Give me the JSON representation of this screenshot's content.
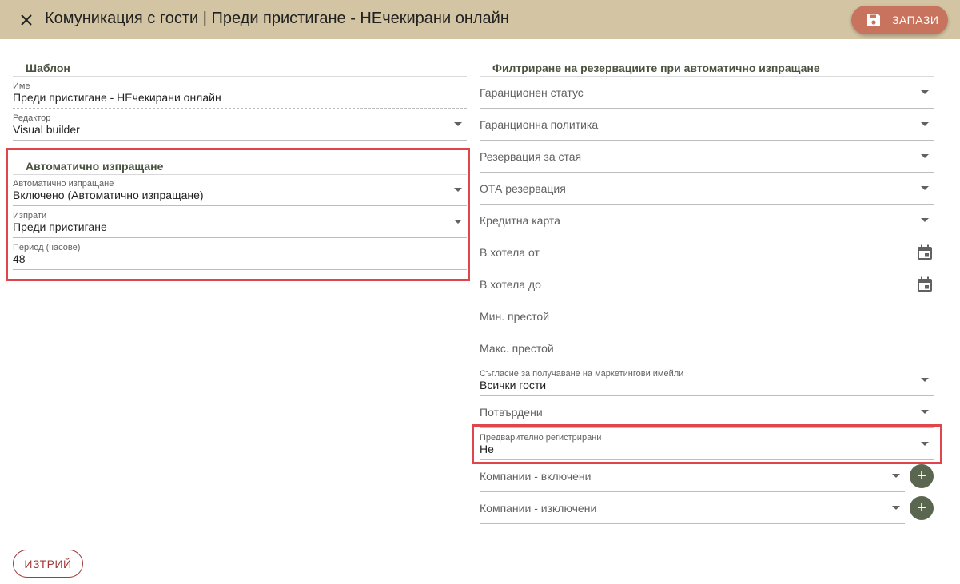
{
  "header": {
    "title": "Комуникация с гости | Преди пристигане - НЕчекирани онлайн",
    "save_label": "ЗАПАЗИ"
  },
  "template_section": {
    "title": "Шаблон",
    "name_label": "Име",
    "name_value": "Преди пристигане - НЕчекирани онлайн",
    "editor_label": "Редактор",
    "editor_value": "Visual builder"
  },
  "auto_send_section": {
    "title": "Автоматично изпращане",
    "auto_label": "Автоматично изпращане",
    "auto_value": "Включено (Автоматично изпращане)",
    "send_label": "Изпрати",
    "send_value": "Преди пристигане",
    "period_label": "Период (часове)",
    "period_value": "48"
  },
  "filter_section": {
    "title": "Филтриране на резервациите при автоматично изпращане",
    "guarantee_status": "Гаранционен статус",
    "guarantee_policy": "Гаранционна политика",
    "room_reservation": "Резервация за стая",
    "ota_reservation": "ОТА резервация",
    "credit_card": "Кредитна карта",
    "in_hotel_from": "В хотела от",
    "in_hotel_to": "В хотела до",
    "min_stay": "Мин. престой",
    "max_stay": "Макс. престой",
    "marketing_label": "Съгласие за получаване на маркетингови имейли",
    "marketing_value": "Всички гости",
    "confirmed": "Потвърдени",
    "preregistered_label": "Предварително регистрирани",
    "preregistered_value": "Не",
    "companies_included": "Компании - включени",
    "companies_excluded": "Компании - изключени"
  },
  "footer": {
    "delete_label": "ИЗТРИЙ"
  },
  "icons": {
    "close": "close-icon",
    "save": "floppy-disk-icon",
    "dropdown": "chevron-down-icon",
    "calendar": "calendar-icon",
    "add": "plus-icon"
  },
  "colors": {
    "header_bg": "#d3c5a3",
    "save_button": "#c8735d",
    "add_button": "#5b6650",
    "delete_text": "#a23a3a",
    "highlight": "#e0454b",
    "section_title": "#4a5240"
  }
}
